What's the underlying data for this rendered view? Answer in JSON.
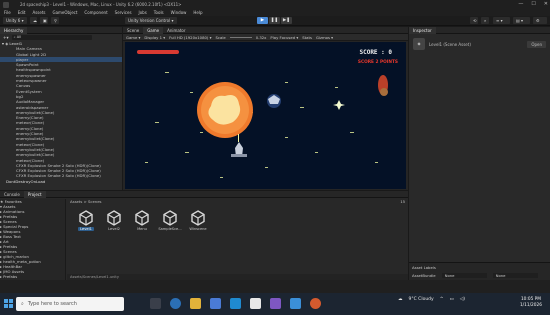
{
  "window": {
    "title": "2d spaceship3 - Level1 - Windows, Mac, Linux - Unity 6.2 (6000.2.10f1) <DX11>",
    "controls": [
      "—",
      "☐",
      "✕"
    ]
  },
  "menu": [
    "File",
    "Edit",
    "Assets",
    "GameObject",
    "Component",
    "Services",
    "Jobs",
    "Tools",
    "Window",
    "Help"
  ],
  "toolbar": {
    "account": "Unity 6 ▾",
    "version_control": "Unity Version Control ▾",
    "play": [
      "▶",
      "❚❚",
      "▶❚"
    ]
  },
  "hierarchy": {
    "tab": "Hierarchy",
    "search_placeholder": "All",
    "scene_root": "Level1",
    "items": [
      "Main Camera",
      "Global Light 2D",
      "player",
      "SpawnPoint",
      "healthspawnpoint",
      "enemyspawner",
      "meteorspawner",
      "Canvas",
      "EventSystem",
      "bg2",
      "AudioManager",
      "asteroidspawner",
      "enemybullet(Clone)",
      "Enemy(Clone)",
      "meteor(Clone)",
      "enemy(Clone)",
      "enemy(Clone)",
      "enemybullet(Clone)",
      "meteor(Clone)",
      "enemybullet(Clone)",
      "enemybullet(Clone)",
      "meteor(Clone)",
      "CFXR Explosion Smoke 2 Solo (HDR)(Clone)",
      "CFXR Explosion Smoke 2 Solo (HDR)(Clone)",
      "CFXR Explosion Smoke 2 Solo (HDR)(Clone)",
      "DontDestroyOnLoad"
    ]
  },
  "scene_tabs": [
    "Scene",
    "Game",
    "Animator"
  ],
  "game_toolbar": {
    "mode": "Game ▾",
    "display": "Display 1 ▾",
    "resolution": "Full HD (1920x1080) ▾",
    "scale": "Scale",
    "scale_value": "0.32x",
    "play_focus": "Play Focused ▾",
    "stats": "Stats",
    "gizmos": "Gizmos ▾"
  },
  "game": {
    "score": "SCORE : 0",
    "score_popup": "SCORE 2 POINTS"
  },
  "inspector": {
    "tab": "Inspector",
    "object": "Level1 (Scene Asset)",
    "open_button": "Open",
    "asset_labels": "Asset Labels",
    "asset_bundle": "AssetBundle",
    "asset_bundle_value": "None",
    "variant_value": "None"
  },
  "project": {
    "tabs": [
      "Console",
      "Project"
    ],
    "tree": [
      "★ Favorites",
      "▾ Assets",
      "  ▸ Animations",
      "  ▸ Prefabs",
      "  ▸ Scenes",
      "  ▸ Special Props",
      "  ▸ Weapons",
      "  ▸ Boss Text",
      "  ▸ Art",
      "  ▸ Prefabs",
      "  ▸ Scenes",
      "  ▸ glitch_marlon",
      "  ▸ health_meta_potion",
      "  ▸ HealthBar",
      "  ▸ JMO Assets",
      "  ▸ Prefabs",
      "  ▸ Scenes"
    ],
    "breadcrumb": "Assets > Scenes",
    "assets": [
      {
        "name": "Level1",
        "selected": true
      },
      {
        "name": "Level2",
        "selected": false
      },
      {
        "name": "Menu",
        "selected": false
      },
      {
        "name": "SampleSce...",
        "selected": false
      },
      {
        "name": "Winscene",
        "selected": false
      }
    ],
    "footer": "Assets/Scenes/Level1.unity",
    "item_count": "15"
  },
  "taskbar": {
    "search_placeholder": "Type here to search",
    "weather": "9°C Cloudy",
    "time": "10:05 PM",
    "date": "1/11/2026"
  },
  "colors": {
    "accent": "#4a8ad6",
    "selection": "#2d4a6d",
    "game_bg": "#041126",
    "score_text": "#f0f0f0",
    "score_popup": "#e8382c",
    "health_bar": "#d83a32"
  }
}
